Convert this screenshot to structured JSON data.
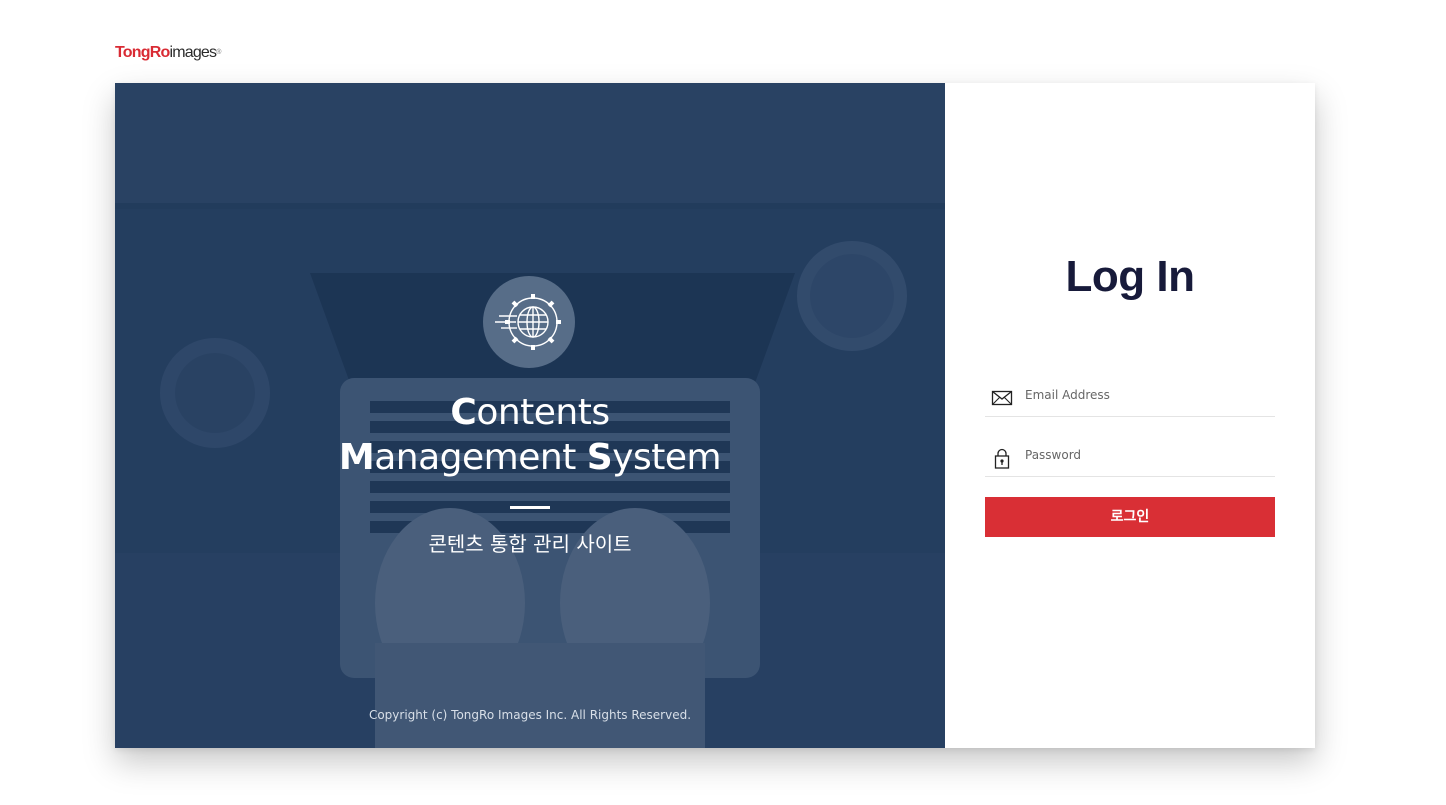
{
  "logo": {
    "part_red": "TongRo",
    "part_dark": "images",
    "registered": "®"
  },
  "hero": {
    "emblem_icon": "globe-gear-icon",
    "title_line1": {
      "cap": "C",
      "rest": "ontents"
    },
    "title_line2": {
      "cap1": "M",
      "rest1": "anagement ",
      "cap2": "S",
      "rest2": "ystem"
    },
    "subtitle": "콘텐츠 통합 관리 사이트",
    "copyright": "Copyright (c) TongRo Images Inc. All Rights Reserved."
  },
  "login": {
    "heading": "Log In",
    "email": {
      "icon": "envelope-icon",
      "placeholder": "Email Address",
      "value": ""
    },
    "password": {
      "icon": "lock-icon",
      "placeholder": "Password",
      "value": ""
    },
    "submit_label": "로그인"
  },
  "colors": {
    "brand_red": "#d92f35",
    "hero_navy": "#1f3a5a",
    "heading_navy": "#171a3a"
  }
}
